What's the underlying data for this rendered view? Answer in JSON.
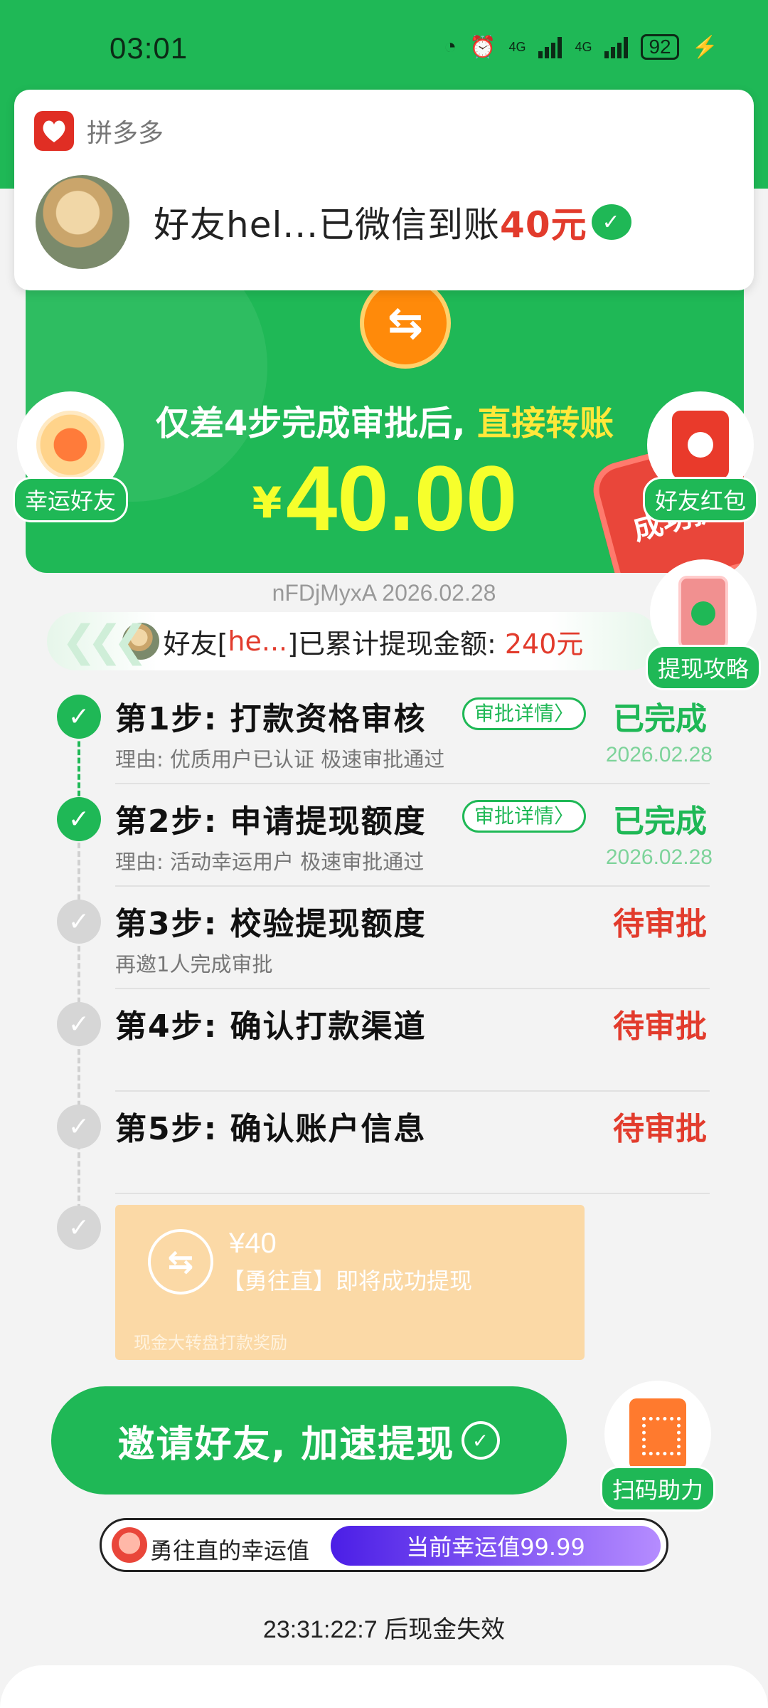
{
  "status_bar": {
    "time": "03:01",
    "network_1": "4G",
    "network_2": "4G",
    "battery": "92"
  },
  "notification": {
    "app_name": "拼多多",
    "message": "好友hel...已微信到账",
    "amount": "40元"
  },
  "banner": {
    "title_prefix": "仅差4步完成审批后,",
    "title_highlight": " 直接转账",
    "currency": "¥",
    "amount": "40.00",
    "stamp": "成功提现"
  },
  "side_items": {
    "lucky_friend": "幸运好友",
    "friend_redpacket": "好友红包",
    "withdraw_guide": "提现攻略",
    "scan_help": "扫码助力"
  },
  "meta_line": "nFDjMyxA 2026.02.28",
  "summary": {
    "prefix": "好友[",
    "name": "he...",
    "middle": "]已累计提现金额:",
    "amount": "240元"
  },
  "steps": [
    {
      "title": "第1步: 打款资格审核",
      "detail_btn": "审批详情〉",
      "status": "已完成",
      "reason": "理由: 优质用户已认证 极速审批通过",
      "date": "2026.02.28"
    },
    {
      "title": "第2步: 申请提现额度",
      "detail_btn": "审批详情〉",
      "status": "已完成",
      "reason": "理由: 活动幸运用户 极速审批通过",
      "date": "2026.02.28"
    },
    {
      "title": "第3步: 校验提现额度",
      "status": "待审批",
      "reason": "再邀1人完成审批"
    },
    {
      "title": "第4步: 确认打款渠道",
      "status": "待审批"
    },
    {
      "title": "第5步: 确认账户信息",
      "status": "待审批"
    }
  ],
  "reward_card": {
    "amount": "¥40",
    "text": "【勇往直】即将成功提现",
    "footer": "现金大转盘打款奖励"
  },
  "invite_button": "邀请好友, 加速提现",
  "luck": {
    "label": "勇往直的幸运值",
    "value_text": "当前幸运值99.99",
    "value": 99.99
  },
  "countdown": "23:31:22:7 后现金失效",
  "colors": {
    "brand_green": "#1fb856",
    "alert_red": "#e23b2c",
    "amount_yellow": "#f6ff2c",
    "luck_purple": "#4b1ee6"
  }
}
